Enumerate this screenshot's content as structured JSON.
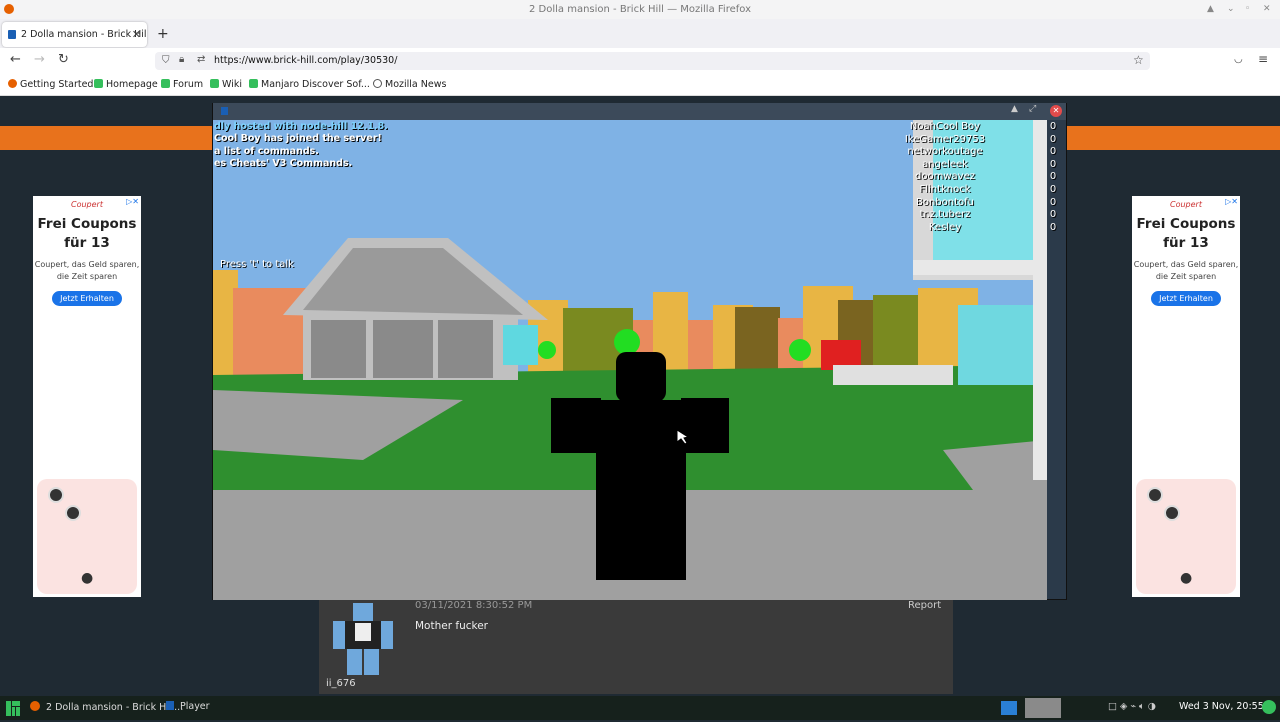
{
  "window": {
    "title": "2 Dolla mansion - Brick Hill — Mozilla Firefox"
  },
  "tab": {
    "title": "2 Dolla mansion - Brick Hill"
  },
  "address": {
    "url": "https://www.brick-hill.com/play/30530/"
  },
  "bookmarks": [
    "Getting Started",
    "Homepage",
    "Forum",
    "Wiki",
    "Manjaro Discover Sof...",
    "Mozilla News"
  ],
  "ads": {
    "headline": "Frei Coupons für 13",
    "body": "Coupert, das Geld sparen, die Zeit sparen",
    "cta": "Jetzt Erhalten",
    "brand": "Coupert"
  },
  "game": {
    "chat": [
      "dly hosted with node-hill 12.1.8.",
      "Cool Boy has joined the server!",
      "a list of commands.",
      "es Cheats' V3 Commands."
    ],
    "talk_hint": "Press 't' to talk",
    "players": [
      {
        "name": "NoahCool Boy",
        "score": "0"
      },
      {
        "name": "IkeGamer29753",
        "score": "0"
      },
      {
        "name": "networkoutage",
        "score": "0"
      },
      {
        "name": "angeleek",
        "score": "0"
      },
      {
        "name": "doomwavez",
        "score": "0"
      },
      {
        "name": "Flintknock",
        "score": "0"
      },
      {
        "name": "Bonbontofu",
        "score": "0"
      },
      {
        "name": "tr.z.tuberz",
        "score": "0"
      },
      {
        "name": "Kesley",
        "score": "0"
      }
    ]
  },
  "comment": {
    "date": "03/11/2021 8:30:52 PM",
    "report": "Report",
    "text": "Mother fucker",
    "user": "ii_676"
  },
  "taskbar": {
    "task1": "2 Dolla mansion - Brick Hill...",
    "task2": "Player",
    "clock": "Wed 3 Nov, 20:55"
  },
  "colors": {
    "accent_orange": "#e8721c",
    "sky": "#7fb2e5",
    "grass": "#2f8f2f",
    "ad_button": "#1a73e8"
  }
}
